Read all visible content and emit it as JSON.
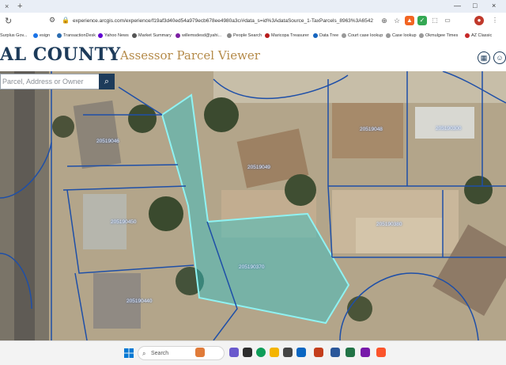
{
  "browser": {
    "tab_close": "×",
    "new_tab": "+",
    "window_controls": [
      "—",
      "□",
      "×"
    ],
    "url": "experience.arcgis.com/experience/f19af3d40ed54a979ecb678ee4980a3c/#data_s=id%3AdataSource_1-TaxParcels_8963%3A654255638zoom_t...",
    "bookmarks": [
      "Surplus Gov...",
      "esign",
      "TransactionDesk",
      "Yahoo News",
      "Market Summary",
      "willemsdesd@yahi...",
      "People Search",
      "Maricopa Treasurer",
      "Data Tree",
      "Court case lookup",
      "Case lookup",
      "Okmulgee Times",
      "AZ Classic"
    ]
  },
  "header": {
    "county": "AL COUNTY",
    "app_title": "Assessor Parcel Viewer"
  },
  "search": {
    "placeholder": "Parcel, Address or Owner"
  },
  "map": {
    "parcels": [
      "20519046",
      "20519049",
      "205190300",
      "205190380",
      "20519048",
      "205190450",
      "205190370",
      "205190440"
    ]
  },
  "taskbar": {
    "search_placeholder": "Search"
  },
  "colors": {
    "selected_parcel": "#2ec4c7",
    "parcel_line": "#1e4fa8",
    "header_text": "#1d3b5a",
    "title_gold": "#b58b4a"
  }
}
